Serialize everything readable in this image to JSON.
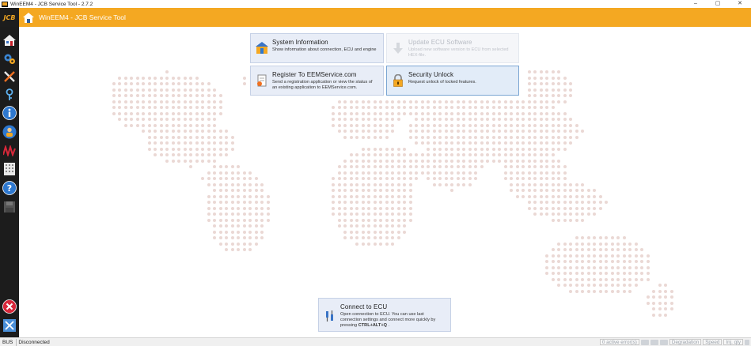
{
  "window": {
    "title": "WinEEM4 - JCB Service Tool - 2.7.2",
    "controls": [
      "–",
      "▢",
      "✕"
    ]
  },
  "header": {
    "brand": "JCB",
    "title": "WinEEM4 - JCB Service Tool"
  },
  "sidebar": {
    "items": [
      {
        "icon": "home-icon"
      },
      {
        "icon": "gears-icon"
      },
      {
        "icon": "tools-icon"
      },
      {
        "icon": "key-icon"
      },
      {
        "icon": "info-icon"
      },
      {
        "icon": "person-icon"
      },
      {
        "icon": "waveform-icon"
      },
      {
        "icon": "grid-icon"
      },
      {
        "icon": "help-icon"
      },
      {
        "icon": "disk-icon"
      },
      {
        "icon": "close-icon"
      },
      {
        "icon": "minimize-window-icon"
      }
    ]
  },
  "tiles": {
    "system_info": {
      "title": "System Information",
      "desc": "Show information about connection, ECU and engine",
      "icon": "system-info-icon"
    },
    "update_ecu": {
      "title": "Update ECU Software",
      "desc": "Upload new software version to ECU from selected HEX-file.",
      "icon": "download-icon",
      "enabled": false
    },
    "register": {
      "title": "Register To EEMService.com",
      "desc": "Send a registration application or view the status of an existing application to EEMService.com.",
      "icon": "register-document-icon"
    },
    "security_unlock": {
      "title": "Security Unlock",
      "desc": "Request unlock of locked features.",
      "icon": "padlock-icon"
    },
    "connect_ecu": {
      "title": "Connect to ECU",
      "desc_1": "Open connection to ECU. You can use last connection settings and connect more quickly by pressing ",
      "shortcut": "CTRL+ALT+Q",
      "desc_2": " .",
      "icon": "connect-cable-icon"
    }
  },
  "status": {
    "bus_label": "BUS",
    "connection": "Disconnected",
    "active_errors": "0 active error(s)",
    "degradation": "Degradation",
    "speed": "Speed",
    "inj_qty": "Inj. qty"
  },
  "colors": {
    "accent": "#f4a822",
    "sidebar": "#1c1c1c",
    "tile_bg": "#e8edf7",
    "map_dot": "#ead8d4"
  }
}
